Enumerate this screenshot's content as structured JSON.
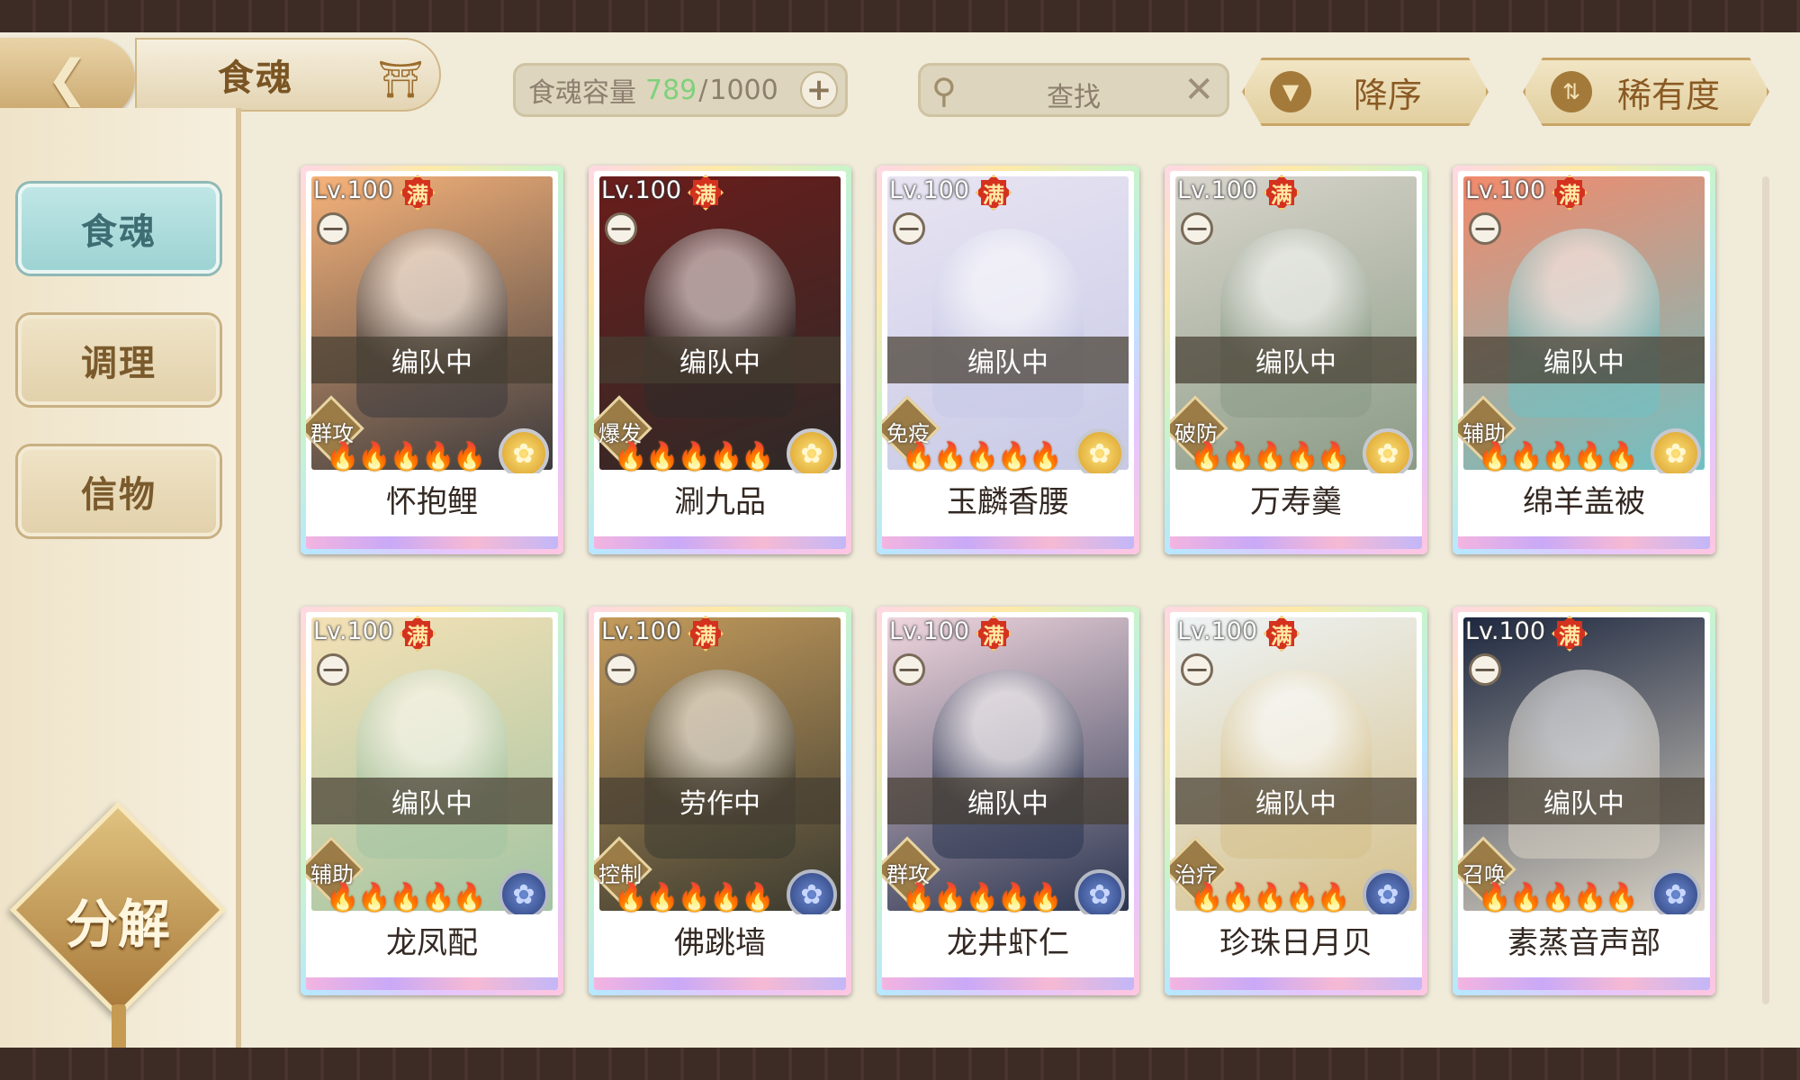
{
  "header": {
    "back_icon": "back-arrow-icon",
    "title": "食魂",
    "home_icon": "pavilion-icon",
    "capacity": {
      "label": "食魂容量",
      "used": "789",
      "separator": "/",
      "max": "1000",
      "add_label": "+"
    },
    "search": {
      "placeholder": "查找",
      "clear_label": "✕"
    },
    "sort_order": {
      "label": "降序",
      "icon": "triangle-down-icon"
    },
    "sort_key": {
      "label": "稀有度",
      "icon": "swap-icon"
    }
  },
  "sidebar": {
    "tabs": [
      {
        "label": "食魂",
        "active": true
      },
      {
        "label": "调理",
        "active": false
      },
      {
        "label": "信物",
        "active": false
      }
    ],
    "decompose_label": "分解"
  },
  "cards": [
    {
      "level": "Lv.100",
      "max_badge": "满",
      "lock": "一",
      "status": "编队中",
      "role": "群攻",
      "stars": "🔥🔥🔥🔥🔥",
      "rarity": "gold",
      "name": "怀抱鲤",
      "colors": [
        "#f7b37a",
        "#3c3a3d"
      ]
    },
    {
      "level": "Lv.100",
      "max_badge": "满",
      "lock": "一",
      "status": "编队中",
      "role": "爆发",
      "stars": "🔥🔥🔥🔥🔥",
      "rarity": "gold",
      "name": "涮九品",
      "colors": [
        "#6a1d1b",
        "#2d2a28"
      ]
    },
    {
      "level": "Lv.100",
      "max_badge": "满",
      "lock": "一",
      "status": "编队中",
      "role": "免疫",
      "stars": "🔥🔥🔥🔥🔥",
      "rarity": "gold",
      "name": "玉麟香腰",
      "colors": [
        "#e8e4f2",
        "#c7c9e6"
      ]
    },
    {
      "level": "Lv.100",
      "max_badge": "满",
      "lock": "一",
      "status": "编队中",
      "role": "破防",
      "stars": "🔥🔥🔥🔥🔥",
      "rarity": "gold",
      "name": "万寿羹",
      "colors": [
        "#d9d5cc",
        "#8a9b86"
      ]
    },
    {
      "level": "Lv.100",
      "max_badge": "满",
      "lock": "一",
      "status": "编队中",
      "role": "辅助",
      "stars": "🔥🔥🔥🔥🔥",
      "rarity": "gold",
      "name": "绵羊盖被",
      "colors": [
        "#f28a6c",
        "#6fc1c4"
      ]
    },
    {
      "level": "Lv.100",
      "max_badge": "满",
      "lock": "一",
      "status": "编队中",
      "role": "辅助",
      "stars": "🔥🔥🔥🔥🔥",
      "rarity": "blue",
      "name": "龙凤配",
      "colors": [
        "#f5e1b6",
        "#a3c4a2"
      ]
    },
    {
      "level": "Lv.100",
      "max_badge": "满",
      "lock": "一",
      "status": "劳作中",
      "role": "控制",
      "stars": "🔥🔥🔥🔥🔥",
      "rarity": "blue",
      "name": "佛跳墙",
      "colors": [
        "#c49b5c",
        "#3a3a30"
      ]
    },
    {
      "level": "Lv.100",
      "max_badge": "满",
      "lock": "一",
      "status": "编队中",
      "role": "群攻",
      "stars": "🔥🔥🔥🔥🔥",
      "rarity": "blue",
      "name": "龙井虾仁",
      "colors": [
        "#f0d6de",
        "#2b3550"
      ]
    },
    {
      "level": "Lv.100",
      "max_badge": "满",
      "lock": "一",
      "status": "编队中",
      "role": "治疗",
      "stars": "🔥🔥🔥🔥🔥",
      "rarity": "blue",
      "name": "珍珠日月贝",
      "colors": [
        "#eef3f5",
        "#d5c08a"
      ]
    },
    {
      "level": "Lv.100",
      "max_badge": "满",
      "lock": "一",
      "status": "编队中",
      "role": "召唤",
      "stars": "🔥🔥🔥🔥🔥",
      "rarity": "blue",
      "name": "素蒸音声部",
      "colors": [
        "#1e2840",
        "#d9d2c4"
      ]
    }
  ]
}
